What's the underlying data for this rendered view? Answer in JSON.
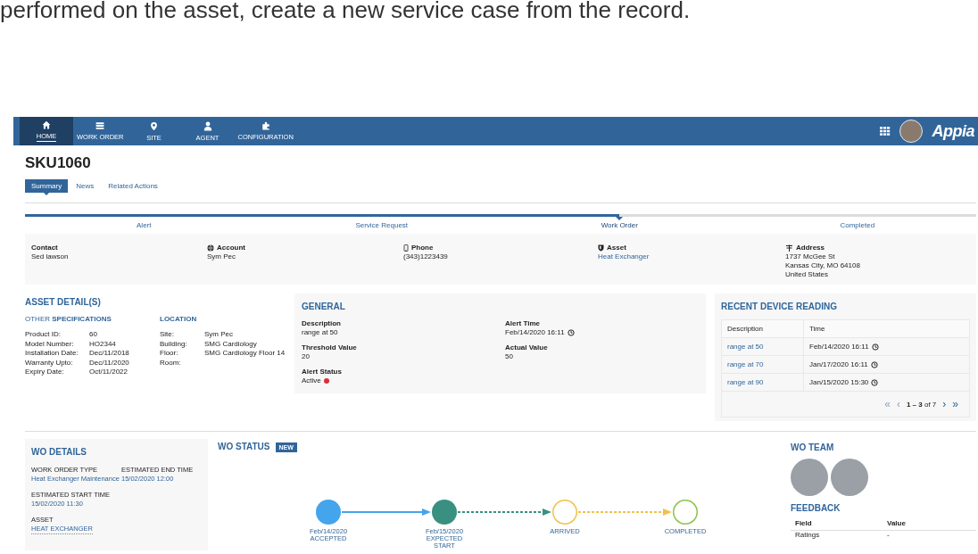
{
  "caption": "performed on the asset, create a new service case from the record.",
  "nav": {
    "items": [
      {
        "label": "HOME",
        "selected": true
      },
      {
        "label": "WORK ORDER",
        "selected": false
      },
      {
        "label": "SITE",
        "selected": false
      },
      {
        "label": "AGENT",
        "selected": false
      },
      {
        "label": "CONFIGURATION",
        "selected": false
      }
    ],
    "logo": "Appia"
  },
  "record": {
    "title": "SKU1060",
    "tabs": [
      {
        "label": "Summary",
        "selected": true
      },
      {
        "label": "News",
        "selected": false
      },
      {
        "label": "Related Actions",
        "selected": false
      }
    ]
  },
  "steps": [
    {
      "label": "Alert",
      "selected": false
    },
    {
      "label": "Service Request",
      "selected": false
    },
    {
      "label": "Work Order",
      "selected": true
    },
    {
      "label": "Completed",
      "selected": false
    }
  ],
  "info": [
    {
      "label": "Contact",
      "kind": "text",
      "values": [
        "Sed lawson"
      ]
    },
    {
      "label": "Account",
      "kind": "text",
      "values": [
        "Sym Pec"
      ]
    },
    {
      "label": "Phone",
      "kind": "text",
      "values": [
        "(343)1223439"
      ]
    },
    {
      "label": "Asset",
      "kind": "link",
      "values": [
        "Heat Exchanger"
      ]
    },
    {
      "label": "Address",
      "kind": "text",
      "values": [
        "1737 McGee St",
        "Kansas City, MO 64108",
        "United States"
      ]
    }
  ],
  "asset_details": {
    "heading": "**ASSET** DETAIL(S)",
    "specifications": {
      "heading": "OTHER **SPECIFICATIONS**",
      "rows": [
        {
          "label": "Product ID:",
          "value": "60"
        },
        {
          "label": "Model Number:",
          "value": "HO2344"
        },
        {
          "label": "Installation Date:",
          "value": "Dec/11/2018"
        },
        {
          "label": "Warranty Upto:",
          "value": "Dec/11/2020"
        },
        {
          "label": "Expiry Date:",
          "value": "Oct/11/2022"
        }
      ]
    },
    "location": {
      "heading": "LOCATION",
      "rows": [
        {
          "label": "Site:",
          "value": "Sym Pec"
        },
        {
          "label": "Building:",
          "value": "SMG Cardiology"
        },
        {
          "label": "Floor:",
          "value": "SMG Cardiology Floor 14"
        },
        {
          "label": "Room:"
        }
      ]
    }
  },
  "general": {
    "heading": "GENERAL",
    "fields": [
      {
        "label": "Description",
        "value": "range at 50",
        "kind": "text"
      },
      {
        "label": "Alert Time",
        "value": "Feb/14/2020 16:11",
        "kind": "time"
      },
      {
        "label": "Threshold Value",
        "value": "20",
        "kind": "text"
      },
      {
        "label": "Actual Value",
        "value": "50",
        "kind": "text"
      },
      {
        "label": "Alert Status",
        "value": "Active",
        "kind": "status",
        "color": "#d9303a"
      }
    ]
  },
  "readings": {
    "heading": "**RECENT** DEVICE READING",
    "columns": [
      "Description",
      "Time"
    ],
    "rows": [
      {
        "description": "range at 50",
        "time": "Feb/14/2020 16:11"
      },
      {
        "description": "range at 70",
        "time": "Jan/17/2020 16:11"
      },
      {
        "description": "range at 90",
        "time": "Jan/15/2020 15:30"
      }
    ],
    "pager": {
      "before": [
        {
          "glyph": "«",
          "disabled": true
        },
        {
          "glyph": "‹",
          "disabled": true
        }
      ],
      "range": "**1 – 3** of 7",
      "after": [
        {
          "glyph": "›",
          "disabled": false
        },
        {
          "glyph": "»",
          "disabled": false
        }
      ]
    }
  },
  "wo_details": {
    "heading": "**WO** DETAILS",
    "fields": [
      {
        "label": "WORK ORDER TYPE",
        "value": "Heat Exchanger Maintenance",
        "kind": "link"
      },
      {
        "label": "ESTIMATED END TIME",
        "value": "15/02/2020 12:00",
        "kind": "link"
      },
      {
        "label": "ESTIMATED START TIME",
        "value": "15/02/2020 11:30",
        "kind": "link"
      },
      {
        "label": "ASSET",
        "value": "HEAT EXCHANGER",
        "kind": "dotted-link"
      }
    ]
  },
  "wo_status": {
    "heading": "**WO** STATUS",
    "badge": "NEW",
    "nodes": [
      {
        "date": "Feb/14/2020",
        "label": "ACCEPTED",
        "color": "#44a4ec",
        "kind": "filled"
      },
      {
        "date": "Feb/15/2020",
        "label": "EXPECTED START",
        "color": "#3a9080",
        "kind": "filled"
      },
      {
        "label": "ARRIVED",
        "color": "#f0c24a",
        "kind": "ring"
      },
      {
        "label": "COMPLETED",
        "color": "#8bc34a",
        "kind": "ring"
      }
    ],
    "links": [
      {
        "color": "#44a4ec",
        "kind": "solid"
      },
      {
        "color": "#3a9080",
        "kind": "dashed"
      },
      {
        "color": "#f0c24a",
        "kind": "dashed"
      }
    ]
  },
  "wo_team": {
    "heading": "**WO** TEAM",
    "members": [
      {
        "kind": "photo"
      },
      {
        "kind": "photo"
      }
    ]
  },
  "feedback": {
    "heading": "FEEDBACK",
    "columns": [
      "Field",
      "Value"
    ],
    "rows": [
      {
        "field": "Ratings",
        "value": "-"
      }
    ]
  }
}
